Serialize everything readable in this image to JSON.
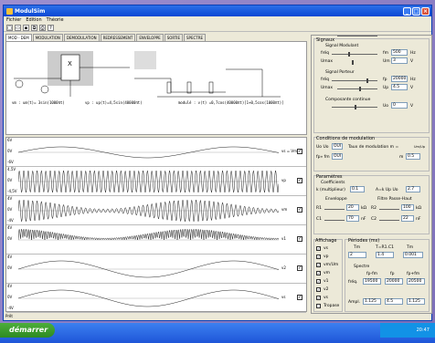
{
  "window": {
    "title": "ModulSim"
  },
  "menu": [
    "Fichier",
    "Edition",
    "Théorie"
  ],
  "tabs": [
    "MOD - DEM",
    "MODULATION",
    "DEMODULATION",
    "REDRESSEMENT",
    "ENVELOPPE",
    "SORTIE",
    "SPECTRE"
  ],
  "diagram": {
    "block_label": "X",
    "eq1": "vm : um(t)= 3sin(1000πt)",
    "eq2": "vp : up(t)=4,5sin(40000πt)",
    "eq3": "modulé : v(t) =0,7cos(40000πt)[1+0,5cos(1000πt)]"
  },
  "scopes": [
    {
      "top": "6V",
      "mid": "0V",
      "bot": "-6V",
      "label": "vs = Vm"
    },
    {
      "top": "4,5V",
      "mid": "0V",
      "bot": "-4,5V",
      "label": "vp"
    },
    {
      "top": "4V",
      "mid": "0V",
      "bot": "-4V",
      "label": "vm"
    },
    {
      "top": "4V",
      "mid": "0V",
      "bot": "",
      "label": "v1"
    },
    {
      "top": "4V",
      "mid": "0V",
      "bot": "",
      "label": "v2"
    },
    {
      "top": "4V",
      "mid": "0V",
      "bot": "-4V",
      "label": "vs"
    }
  ],
  "signaux": {
    "title": "Signaux",
    "mod_title": "Signal Modulant",
    "fmod_label": "fréq",
    "fmod": "500",
    "fmod_unit": "Hz",
    "amp_label": "Umax",
    "amp_val": "3",
    "amp_unit": "V",
    "amp_lab2": "Um",
    "porteur_title": "Signal Porteur",
    "fp": "20000",
    "fp_unit": "Hz",
    "up_label": "Up",
    "up": "4.5",
    "up_unit": "V",
    "cont_title": "Composante continue",
    "uo_label": "Uo",
    "uo": "0",
    "uo_unit": "V"
  },
  "cond": {
    "title": "Conditions de modulation",
    "uo_uo": "Uo Uo",
    "uo_val": "OUI",
    "taux_label": "Taux de modulation m =",
    "m_unit": "Um/Up",
    "fp_fm": "fp» fm",
    "fp_val": "OUI",
    "m_label": "m",
    "m_val": "0.5"
  },
  "param": {
    "title": "Paramètres",
    "coef": "Coefficients",
    "k_label": "k (multiplieur)",
    "k": "0.1",
    "a_label": "A=k Up Uo",
    "a": "2.7",
    "env": "Enveloppe",
    "filtre": "Filtre Passe-Haut",
    "r1": "20",
    "r1u": "kΩ",
    "r2": "100",
    "r2u": "kΩ",
    "c1": "70",
    "c1u": "nF",
    "c2": "22",
    "c2u": "nF"
  },
  "affichage": {
    "title": "Affichage",
    "items": [
      "vs",
      "vp",
      "vm/Um",
      "vm",
      "v1",
      "v2",
      "vs",
      "Tropase"
    ]
  },
  "periodes": {
    "title": "Périodes (ms)",
    "tm_label": "Tm",
    "tm": "2",
    "trc_label": "T=R1.C1",
    "trc": "1.4",
    "tp_label": "Tm",
    "tp": "0.001"
  },
  "spectre": {
    "title": "Spectre",
    "freq_label": "fréq.",
    "f1": "19500",
    "f2": "20000",
    "f3": "20500",
    "ampl_label": "Ampl.",
    "a1": "1.125",
    "a2": "4.5",
    "a3": "1.125",
    "h1": "fp-fm",
    "h2": "fp",
    "h3": "fp+fm"
  },
  "status": "Prêt",
  "taskbar": {
    "start": "démarrer",
    "time": "20:47"
  }
}
